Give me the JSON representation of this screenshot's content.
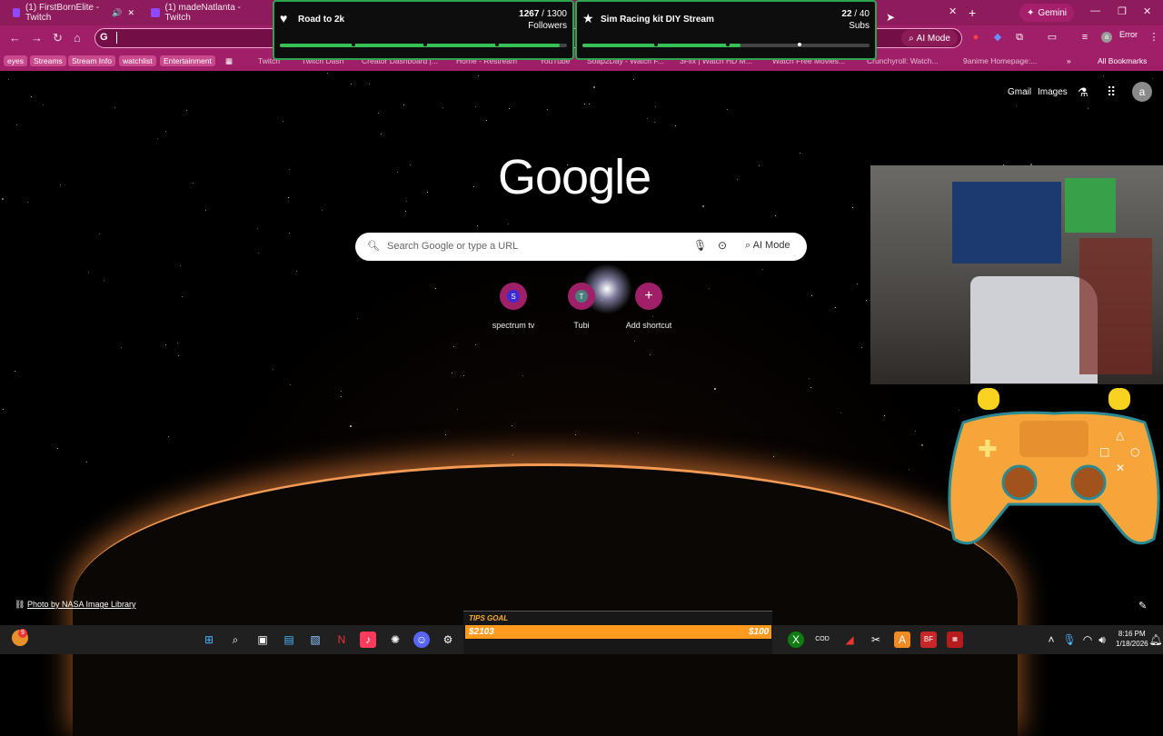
{
  "browser": {
    "tabs": [
      {
        "label": "(1) FirstBornElite - Twitch"
      },
      {
        "label": "(1) madeNatlanta - Twitch"
      }
    ],
    "new_tab_symbol": "+",
    "gemini_label": "Gemini",
    "omnibox_value": "",
    "ai_mode_label": "AI Mode",
    "error_label": "Error",
    "bookmarks": [
      "eyes",
      "Streams",
      "Stream Info",
      "watchlist",
      "Entertainment",
      "Twitch",
      "Twitch Dash",
      "Creator Dashboard |...",
      "Home - Restream",
      "YouTube",
      "Soap2Day - Watch F...",
      "3Flix | Watch HD M...",
      "Watch Free Movies...",
      "Crunchyroll: Watch...",
      "9anime Homepage:...",
      "All Bookmarks"
    ]
  },
  "overlays": {
    "followers_goal": {
      "title": "Road to 2k",
      "current": "1267",
      "target": "1300",
      "unit": "Followers",
      "progress": 0.975
    },
    "subs_goal": {
      "title": "Sim Racing kit DIY Stream",
      "current": "22",
      "target": "40",
      "unit": "Subs",
      "progress": 0.55
    },
    "tips_goal": {
      "title": "TIPS GOAL",
      "current": "$2103",
      "target": "$100"
    }
  },
  "newtab": {
    "logo": "Google",
    "search_placeholder": "Search Google or type a URL",
    "ai_mode_label": "AI Mode",
    "shortcuts": [
      {
        "label": "spectrum tv",
        "initial": "S"
      },
      {
        "label": "Tubi",
        "initial": "T"
      },
      {
        "label": "Add shortcut",
        "initial": "+"
      }
    ],
    "header_links": {
      "gmail": "Gmail",
      "images": "Images",
      "account_initial": "a"
    },
    "photo_credit": "Photo by NASA Image Library"
  },
  "taskbar": {
    "time": "8:16 PM",
    "date": "1/18/2026",
    "notification_count": "9"
  },
  "colors": {
    "accent": "#a01f69",
    "tab_strip": "#8e1b5c",
    "goal_green": "#35c155",
    "tips_orange": "#ff9a1f"
  }
}
